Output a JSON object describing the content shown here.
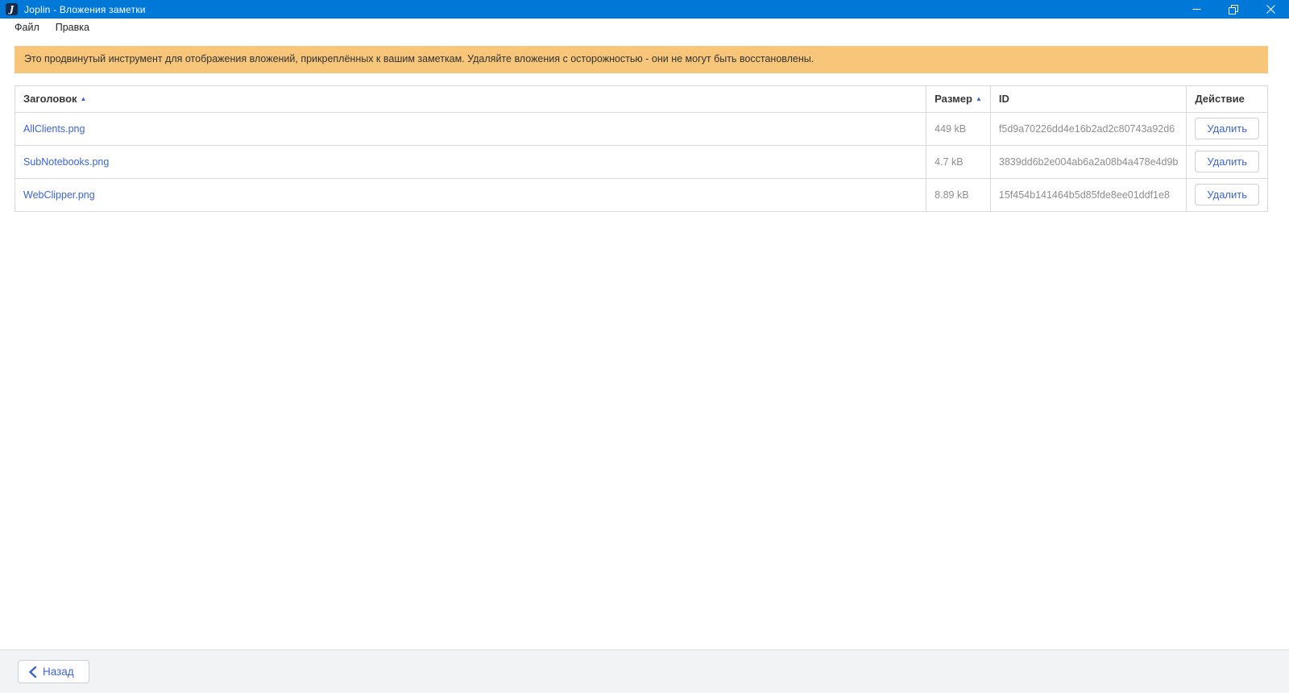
{
  "window": {
    "app_initial": "J",
    "title": "Joplin - Вложения заметки"
  },
  "menu": {
    "items": [
      {
        "label": "Файл"
      },
      {
        "label": "Правка"
      }
    ]
  },
  "banner": {
    "text": "Это продвинутый инструмент для отображения вложений, прикреплённых к вашим заметкам. Удаляйте вложения с осторожностью - они не могут быть восстановлены."
  },
  "table": {
    "headers": {
      "title": "Заголовок",
      "size": "Размер",
      "id": "ID",
      "action": "Действие"
    },
    "sort_arrow": "▲",
    "rows": [
      {
        "title": "AllClients.png",
        "size": "449 kB",
        "id": "f5d9a70226dd4e16b2ad2c80743a92d6",
        "action": "Удалить"
      },
      {
        "title": "SubNotebooks.png",
        "size": "4.7 kB",
        "id": "3839dd6b2e004ab6a2a08b4a478e4d9b",
        "action": "Удалить"
      },
      {
        "title": "WebClipper.png",
        "size": "8.89 kB",
        "id": "15f454b141464b5d85fde8ee01ddf1e8",
        "action": "Удалить"
      }
    ]
  },
  "footer": {
    "back_label": "Назад"
  },
  "colors": {
    "titlebar": "#0078d7",
    "banner_bg": "#f7c67a",
    "link": "#3c64d6",
    "muted": "#8e8e8e"
  }
}
